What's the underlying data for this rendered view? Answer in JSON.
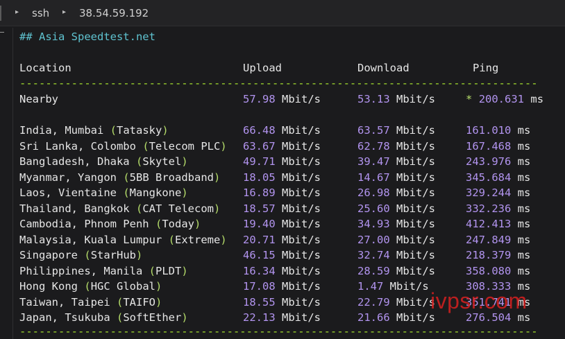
{
  "breadcrumb": {
    "item1": "ssh",
    "item2": "38.54.59.192",
    "arrow": "▸"
  },
  "section_title": "## Asia Speedtest.net",
  "headers": {
    "location": "Location",
    "upload": "Upload",
    "download": "Download",
    "ping": "Ping"
  },
  "separator": "--------------------------------------------------------------------------------",
  "nearby": {
    "label": "Nearby",
    "upload": "57.98",
    "download": "53.13",
    "unit": "Mbit/s",
    "star": "*",
    "ping": "200.631",
    "ping_unit": "ms"
  },
  "rows": [
    {
      "place": "India, Mumbai",
      "isp": "Tatasky",
      "upload": "66.48",
      "download": "63.57",
      "ping": "161.010"
    },
    {
      "place": "Sri Lanka, Colombo",
      "isp": "Telecom PLC",
      "upload": "63.67",
      "download": "62.78",
      "ping": "167.468"
    },
    {
      "place": "Bangladesh, Dhaka",
      "isp": "Skytel",
      "upload": "49.71",
      "download": "39.47",
      "ping": "243.976"
    },
    {
      "place": "Myanmar, Yangon",
      "isp": "5BB Broadband",
      "upload": "18.05",
      "download": "14.67",
      "ping": "345.684"
    },
    {
      "place": "Laos, Vientaine",
      "isp": "Mangkone",
      "upload": "16.89",
      "download": "26.98",
      "ping": "329.244"
    },
    {
      "place": "Thailand, Bangkok",
      "isp": "CAT Telecom",
      "upload": "18.57",
      "download": "25.60",
      "ping": "332.236"
    },
    {
      "place": "Cambodia, Phnom Penh",
      "isp": "Today",
      "upload": "19.40",
      "download": "34.93",
      "ping": "412.413"
    },
    {
      "place": "Malaysia, Kuala Lumpur",
      "isp": "Extreme",
      "upload": "20.71",
      "download": "27.00",
      "ping": "247.849"
    },
    {
      "place": "Singapore",
      "isp": "StarHub",
      "upload": "46.15",
      "download": "32.74",
      "ping": "218.379"
    },
    {
      "place": "Philippines, Manila",
      "isp": "PLDT",
      "upload": "16.34",
      "download": "28.59",
      "ping": "358.080"
    },
    {
      "place": "Hong Kong",
      "isp": "HGC Global",
      "upload": "17.08",
      "download": "1.47",
      "ping": "308.333"
    },
    {
      "place": "Taiwan, Taipei",
      "isp": "TAIFO",
      "upload": "18.55",
      "download": "22.79",
      "ping": "351.741"
    },
    {
      "place": "Japan, Tsukuba",
      "isp": "SoftEther",
      "upload": "22.13",
      "download": "21.66",
      "ping": "276.504"
    }
  ],
  "units": {
    "speed": "Mbit/s",
    "ping": "ms"
  },
  "watermark": "ivpsr.com",
  "colors": {
    "cyan": "#5fc3d0",
    "purple": "#b294ef",
    "green": "#b5dd6a",
    "text": "#e6e6e6",
    "background": "#1b1b1d"
  }
}
